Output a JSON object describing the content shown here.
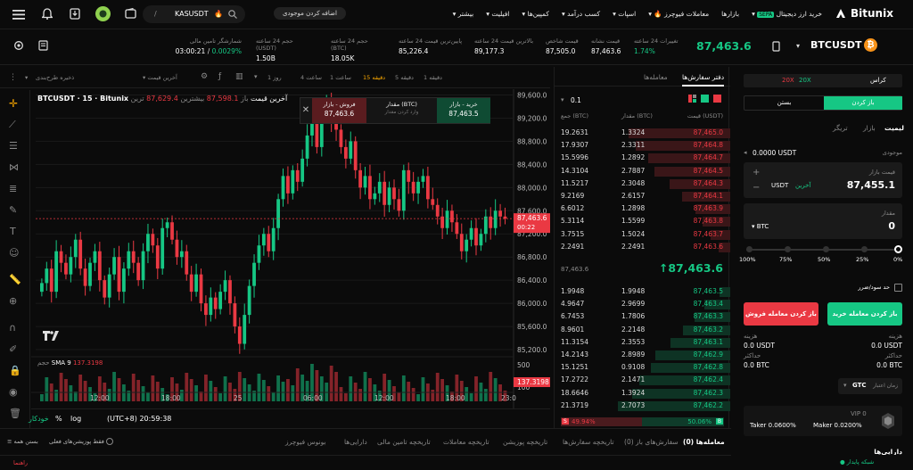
{
  "nav": {
    "brand": "Bitunix",
    "menu": [
      "خرید ارز دیجیتال",
      "بازارها",
      "معاملات فیوچرز",
      "اسپات",
      "کسب درآمد",
      "کمپین‌ها",
      "افیلیت",
      "بیشتر"
    ],
    "sepa": "SEPA",
    "deposit_btn": "اضافه کردن موجودی",
    "search_value": "KASUSDT",
    "search_hint": "/"
  },
  "ticker": {
    "symbol": "BTCUSDT",
    "last_price": "87,463.6",
    "stats": [
      {
        "label": "تغییرات 24 ساعته",
        "value": "1.74%",
        "color": "green"
      },
      {
        "label": "قیمت نشانه",
        "value": "87,463.6"
      },
      {
        "label": "قیمت شاخص",
        "value": "87,505.0"
      },
      {
        "label": "بالاترین قیمت 24 ساعته",
        "value": "89,177.3"
      },
      {
        "label": "پایین‌ترین قیمت 24 ساعته",
        "value": "85,226.4"
      },
      {
        "label": "حجم 24 ساعته (BTC)",
        "value": "18.05K"
      },
      {
        "label": "حجم 24 ساعته (USDT)",
        "value": "1.50B"
      },
      {
        "label": "شمارشگر تامین مالی",
        "value": "03:00:21",
        "value2": "0.0029%"
      }
    ]
  },
  "chart_toolbar": {
    "intervals": [
      "1 دقیقه",
      "5 دقیقه",
      "15 دقیقه",
      "1 ساعت",
      "4 ساعت",
      "1 روز"
    ],
    "active_interval": "15 دقیقه",
    "last_price_label": "آخرین قیمت",
    "tab_orderbook": "دفتر سفارش‌ها",
    "tab_trades": "معامله‌ها"
  },
  "chart": {
    "header_symbol": "BTCUSDT · 15 · Bitunix",
    "header_last": "آخرین قیمت",
    "header_o": "باز",
    "header_o_val": "87,598.1",
    "header_h": "بیشترین",
    "header_h_val": "87,629.4",
    "header_l": "ترین",
    "sma_label": "حجم",
    "sma_name": "SMA 9",
    "sma_val": "137.3198",
    "volume_tag": "137.3198",
    "price_tag": "87,463.6",
    "price_tag_time": "00:22",
    "scale_labels": [
      "89,600.0",
      "89,200.0",
      "88,800.0",
      "88,400.0",
      "88,000.0",
      "87,600.0",
      "87,200.0",
      "86,800.0",
      "86,400.0",
      "86,000.0",
      "85,600.0",
      "85,200.0"
    ],
    "vol_scale": [
      "500",
      "100"
    ],
    "time_labels": [
      "12:00",
      "18:00",
      "25",
      "06:00",
      "12:00",
      "18:00",
      "23:0"
    ],
    "timezone": "(UTC+8) 20:59:38",
    "opt_log": "log",
    "opt_pct": "%",
    "opt_auto": "خودکار",
    "buy_popup": {
      "title": "خرید - بازار",
      "price": "87,463.5"
    },
    "sell_popup": {
      "title": "فروش - بازار",
      "price": "87,463.6"
    },
    "qty_popup": {
      "title": "مقدار (BTC)",
      "hint": "وارد کردن مقدار"
    }
  },
  "chart_data": {
    "type": "candlestick",
    "title": "BTCUSDT · 15 · Bitunix",
    "ylim": [
      85000,
      89700
    ],
    "last_price": 87463.6,
    "x_ticks": [
      "12:00",
      "18:00",
      "25",
      "06:00",
      "12:00",
      "18:00",
      "23:0"
    ],
    "closes": [
      86350,
      86600,
      86200,
      86900,
      86700,
      86500,
      86800,
      87100,
      86600,
      86300,
      86700,
      86900,
      86400,
      86100,
      86500,
      86800,
      86200,
      86600,
      86900,
      86700,
      86400,
      86900,
      87200,
      87000,
      86600,
      87300,
      87400,
      87100,
      86800,
      86900,
      86500,
      86200,
      86500,
      86000,
      85800,
      86100,
      85900,
      86200,
      86400,
      86000,
      85600,
      85300,
      85800,
      86300,
      86700,
      87000,
      87200,
      86900,
      87300,
      87800,
      88200,
      87900,
      88300,
      88100,
      88500,
      88900,
      89100,
      88700,
      89300,
      89500,
      89100,
      89000,
      88700,
      88500,
      88800,
      88300,
      88000,
      88200,
      87800,
      87900,
      88100,
      87700,
      88000,
      87800,
      87600,
      88300,
      88100,
      87900,
      88100,
      88200,
      87800,
      87700,
      87500,
      87300,
      87600,
      87400,
      87200,
      86900,
      87100,
      87300,
      87000,
      87200,
      87500,
      87300,
      87600,
      87500,
      87463.6
    ]
  },
  "orderbook": {
    "step": "0.1",
    "col_price": "قیمت (USDT)",
    "col_amount": "مقدار (BTC)",
    "col_total": "جمع (BTC)",
    "asks": [
      [
        "87,465.0",
        "1.3324",
        "19.2631"
      ],
      [
        "87,464.8",
        "2.3311",
        "17.9307"
      ],
      [
        "87,464.7",
        "1.2892",
        "15.5996"
      ],
      [
        "87,464.5",
        "2.7887",
        "14.3104"
      ],
      [
        "87,464.3",
        "2.3048",
        "11.5217"
      ],
      [
        "87,464.1",
        "2.6157",
        "9.2169"
      ],
      [
        "87,463.9",
        "1.2898",
        "6.6012"
      ],
      [
        "87,463.8",
        "1.5599",
        "5.3114"
      ],
      [
        "87,463.7",
        "1.5024",
        "3.7515"
      ],
      [
        "87,463.6",
        "2.2491",
        "2.2491"
      ]
    ],
    "mid_price": "87,463.6",
    "mid_mark": "87,463.6",
    "bids": [
      [
        "87,463.5",
        "1.9948",
        "1.9948"
      ],
      [
        "87,463.4",
        "2.9699",
        "4.9647"
      ],
      [
        "87,463.3",
        "1.7806",
        "6.7453"
      ],
      [
        "87,463.2",
        "2.2148",
        "8.9601"
      ],
      [
        "87,463.1",
        "2.3553",
        "11.3154"
      ],
      [
        "87,462.9",
        "2.8989",
        "14.2143"
      ],
      [
        "87,462.8",
        "0.9108",
        "15.1251"
      ],
      [
        "87,462.4",
        "2.1471",
        "17.2722"
      ],
      [
        "87,462.3",
        "1.3924",
        "18.6646"
      ],
      [
        "87,462.2",
        "2.7073",
        "21.3719"
      ]
    ],
    "buy_pct": "50.06%",
    "sell_pct": "49.94%",
    "buy_tag": "B",
    "sell_tag": "S"
  },
  "trade": {
    "margin_mode": "کراس",
    "lev_long": "20X",
    "lev_short": "20X",
    "open_tab": "باز کردن",
    "close_tab": "بستن",
    "order_types": [
      "لیمیت",
      "بازار",
      "تریگر"
    ],
    "balance_label": "موجودی",
    "balance": "0.0000 USDT",
    "price_label": "قیمت بازار",
    "price_value": "87,455.1",
    "price_unit": "USDT",
    "price_latest": "آخرین",
    "qty_label": "مقدار",
    "qty_value": "0",
    "qty_unit": "BTC",
    "slider": [
      "0%",
      "25%",
      "50%",
      "75%",
      "100%"
    ],
    "tpsl": "حد سود/ضرر",
    "buy_btn": "باز کردن معامله خرید",
    "sell_btn": "باز کردن معامله فروش",
    "cost_label": "هزینه",
    "cost_buy": "0.0 USDT",
    "cost_sell": "0.0 USDT",
    "max_label": "حداکثر",
    "max_buy": "0.0 BTC",
    "max_sell": "0.0 BTC",
    "tif_label": "زمان اعتبار",
    "tif_value": "GTC",
    "vip": "VIP 0",
    "maker": "Maker 0.0200%",
    "taker": "Taker 0.0600%",
    "assets_label": "دارایی‌ها"
  },
  "bottom": {
    "tabs": [
      "معامله‌ها (0)",
      "سفارش‌های باز (0)",
      "تاریخچه سفارش‌ها",
      "تاریخچه پوزیشن",
      "تاریخچه معاملات",
      "تاریخچه تامین مالی",
      "دارایی‌ها",
      "بونوس فیوچرز"
    ],
    "hide_label": "فقط پوزیشن‌های فعلی",
    "close_all": "بستن همه"
  },
  "footer": {
    "status": "شبکه پایدار",
    "support": "راهنما"
  },
  "colors": {
    "green": "#16c784",
    "red": "#ea3943",
    "accent": "#f7a600"
  }
}
